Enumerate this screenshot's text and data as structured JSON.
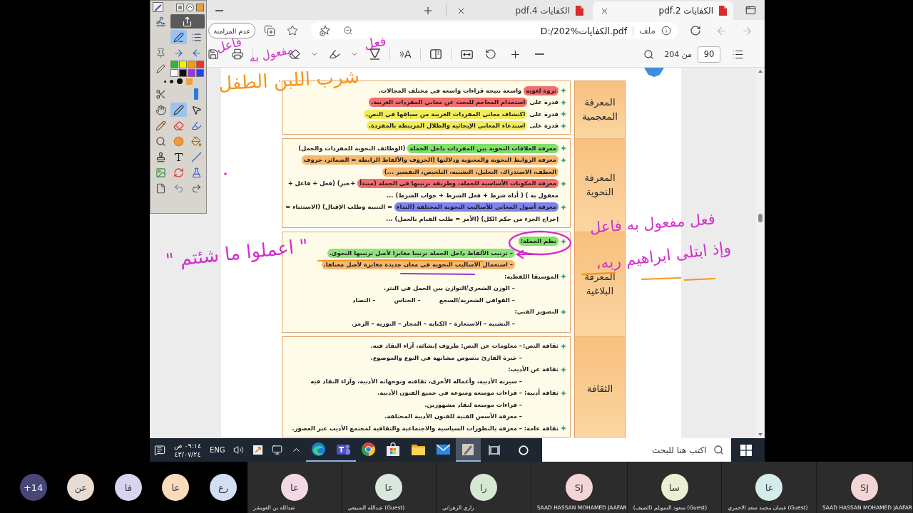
{
  "browser": {
    "tabs": [
      {
        "title": "الكفايات 2.pdf",
        "selected": true
      },
      {
        "title": "الكفايات 4.pdf",
        "selected": false
      }
    ],
    "nav": [
      {
        "kind": "back",
        "disabled": true
      },
      {
        "kind": "forward",
        "disabled": true
      },
      {
        "kind": "refresh",
        "disabled": false
      }
    ],
    "address": {
      "scheme": "ملف",
      "url": "D:/202%الكفايات.pdf"
    },
    "sync_button": "عدم المزامنة"
  },
  "pdf_toolbar": {
    "page": "90",
    "page_count": "من 204",
    "tool_groups": [
      [
        {
          "kind": "zoom_out",
          "menu": false
        },
        {
          "kind": "zoom_in",
          "menu": false
        },
        {
          "kind": "rotate",
          "menu": false
        },
        {
          "kind": "fit_width",
          "menu": false
        }
      ],
      [
        {
          "kind": "page_view",
          "menu": false
        }
      ],
      [
        {
          "kind": "read_aloud",
          "label": "A",
          "menu": false
        }
      ],
      [
        {
          "kind": "draw",
          "menu": true
        },
        {
          "kind": "highlight",
          "menu": true
        },
        {
          "kind": "erase",
          "menu": false
        }
      ],
      [
        {
          "kind": "print",
          "menu": false
        },
        {
          "kind": "save",
          "menu": false
        }
      ]
    ]
  },
  "document": {
    "sections": [
      {
        "heading": "المعرفة المعجمية",
        "kind": "list",
        "lines": [
          {
            "kind": "bullet",
            "parts": [
              {
                "text": "ثروة لغوية",
                "color": "#f26d6d"
              },
              {
                "text": "واسعة نتيجة قراءات واسعة في مختلف المجالات."
              }
            ]
          },
          {
            "kind": "bullet",
            "parts": [
              {
                "text": "قدرة على"
              },
              {
                "text": "استخدام المعاجم للبحث عن معاني المفردات الغريبة.",
                "color": "#f26d6d"
              }
            ]
          },
          {
            "kind": "bullet",
            "parts": [
              {
                "text": "قدرة على"
              },
              {
                "text": "اكتشاف معاني المفردات الغريبة من سياقها في النص.",
                "color": "#f3ec5a"
              }
            ]
          },
          {
            "kind": "bullet",
            "parts": [
              {
                "text": "قدرة على"
              },
              {
                "text": "استدعاء المعاني الإيحائية والظلال المرتبطة بالمفردة.",
                "color": "#f3ec5a"
              }
            ]
          }
        ]
      },
      {
        "heading": "المعرفة النحوية",
        "kind": "list",
        "lines": [
          {
            "kind": "bullet",
            "parts": [
              {
                "text": "معرفة العلاقات النحوية بين المفردات داخل الجملة",
                "color": "#7fe06c"
              },
              {
                "text": "(الوظائف النحوية للمفردات والجمل)"
              }
            ]
          },
          {
            "kind": "bullet",
            "parts": [
              {
                "text": "معرفة الروابط النحوية والمعنوية ودلالتها (الحروف والألفاظ الرابطة = الضمائر، حروف",
                "color": "#f6b86e"
              }
            ]
          },
          {
            "kind": "continuation",
            "parts": [
              {
                "text": "العطف، الاستدراك، التعليل، التشبيه، التلخيص، التفسير ...)",
                "color": "#f6b86e"
              }
            ]
          },
          {
            "kind": "bullet",
            "parts": [
              {
                "text": "معرفة المكونات الأساسية للجملة، وطريقة ترتيبها في الجملة (مبتدأ",
                "color": "#f26d6d"
              },
              {
                "text": "+خبر) (فعل + فاعل +"
              }
            ]
          },
          {
            "kind": "continuation",
            "parts": [
              {
                "text": "معفول به ) ( أداة شرط + فعل الشرط + جواب الشرط) ..."
              }
            ]
          },
          {
            "kind": "bullet",
            "parts": [
              {
                "text": "معرفة أصول المعاني للأساليب النحوية المختلفة (النداء",
                "color": "#7d83ee"
              },
              {
                "text": "= التنبيه وطلب الإقبال) (الاستثناء ="
              }
            ]
          },
          {
            "kind": "continuation",
            "parts": [
              {
                "text": "إخراج الجزء من حكم الكل) (الأمر = طلب القيام بالعمل) ..."
              }
            ]
          }
        ]
      },
      {
        "heading": "المعرفة البلاغية",
        "kind": "list",
        "lines": [
          {
            "kind": "bullet",
            "parts": [
              {
                "text": "نظم الجملة:",
                "color": "#7fe06c"
              }
            ]
          },
          {
            "kind": "dash",
            "parts": [
              {
                "text": "– ترتيب الألفاظ داخل الجملة ترتيبا مغايرا لأصل ترتيبها النحوي.",
                "color": "#8fe27c"
              }
            ]
          },
          {
            "kind": "dash",
            "parts": [
              {
                "text": "– استعمال الأساليب النحوية في معان جديدة مغايرة لأصل معناها.",
                "color": "#f6b86e"
              }
            ]
          },
          {
            "kind": "bullet",
            "parts": [
              {
                "text": "الموسيقا اللفظية:"
              }
            ]
          },
          {
            "kind": "dash",
            "parts": [
              {
                "text": "– الوزن الشعري/التوازن بين الجمل في النثر."
              }
            ]
          },
          {
            "kind": "dash",
            "parts": [
              {
                "text": "– القوافي الشعرية/السجع"
              },
              {
                "text": "– الجناس"
              },
              {
                "text": "– التضاد"
              }
            ]
          },
          {
            "kind": "bullet",
            "parts": [
              {
                "text": "التصوير الفني:"
              }
            ]
          },
          {
            "kind": "dash",
            "parts": [
              {
                "text": "– التشبيه – الاستعارة – الكناية – المجاز – التورية – الرمز."
              }
            ]
          }
        ]
      },
      {
        "heading": "الثقافة",
        "kind": "labeled",
        "rows": [
          {
            "label": "ثقافة النص:",
            "parts": [
              {
                "text": "– معلومات عن النص: ظروف إنشائه، آراء النقاد فيه."
              }
            ]
          },
          {
            "parts": [
              {
                "text": "– خبرة القارئ بنصوص مشابهة في النوع والموضوع."
              }
            ]
          },
          {
            "label": "ثقافة عن الأديب:"
          },
          {
            "parts": [
              {
                "text": "– سيرته الأدبية، وأعماله الأخرى، ثقافته وتوجهاته الأدبية، وآراء النقاد فيه"
              }
            ]
          },
          {
            "label": "ثقافة أدبية:",
            "parts": [
              {
                "text": "– قراءات موسعة ومنوعة في جميع الفنون الأدبية."
              }
            ]
          },
          {
            "parts": [
              {
                "text": "– قراءات موسعة لنقاد مشهورين."
              }
            ]
          },
          {
            "parts": [
              {
                "text": "– معرفة الأسس الفنية للفنون الأدبية المختلفة."
              }
            ]
          },
          {
            "label": "ثقافة عامة:",
            "parts": [
              {
                "text": "– معرفة بالتطورات السياسية والاجتماعية والثقافية لمجتمع الأديب عبر العصور."
              }
            ]
          }
        ]
      }
    ]
  },
  "ink": {
    "texts": [
      {
        "text": "فعل",
        "color": "#d22fce"
      },
      {
        "text": "مفعول به",
        "color": "#d22fce"
      },
      {
        "text": "فاعل",
        "color": "#d22fce"
      },
      {
        "text": "شرب اللبن الطفل",
        "color": "#f5961f"
      },
      {
        "text": "\" اعملوا ما شئتم \"",
        "color": "#d22fce"
      },
      {
        "text": "فعل مفعول به فاعل",
        "color": "#d22fce"
      },
      {
        "text": "وإذ ابتلى ابراهيم ربه،",
        "color": "#d22fce"
      }
    ],
    "strokes": [
      {
        "kind": "ellipse",
        "color": "#d22fce"
      },
      {
        "kind": "arrow",
        "color": "#d22fce"
      },
      {
        "kind": "underline",
        "color": "#f5961f"
      },
      {
        "kind": "underline",
        "color": "#a033d8"
      },
      {
        "kind": "strike",
        "color": "#f5961f"
      },
      {
        "kind": "underline",
        "color": "#f5961f"
      },
      {
        "kind": "dot",
        "color": "#d22fce"
      }
    ]
  },
  "palette": {
    "top_tools": [
      {
        "kind": "signature",
        "selected": false
      },
      {
        "kind": "share",
        "selected": false
      },
      {
        "kind": "ink",
        "selected": true
      },
      {
        "kind": "list",
        "selected": false
      },
      {
        "kind": "pin",
        "selected": false
      },
      {
        "kind": "next",
        "selected": false
      },
      {
        "kind": "previous",
        "selected": false
      }
    ],
    "swatches": [
      {
        "color": "#22c222"
      },
      {
        "color": "#f2f200"
      },
      {
        "color": "#ff9a00"
      },
      {
        "color": "#ff2a2a"
      },
      {
        "color": "#ffffff"
      },
      {
        "color": "#111111"
      },
      {
        "color": "#a52ee8"
      },
      {
        "color": "#2a3cff"
      }
    ],
    "tools": [
      {
        "kind": "clip",
        "selected": false
      },
      {
        "kind": "width",
        "selected": false
      },
      {
        "kind": "hand",
        "selected": false
      },
      {
        "kind": "pen",
        "selected": true
      },
      {
        "kind": "pointer",
        "selected": false
      },
      {
        "kind": "pencil",
        "selected": false
      },
      {
        "kind": "eraser",
        "selected": false
      },
      {
        "kind": "marker",
        "selected": false
      },
      {
        "kind": "magnifier",
        "selected": false
      },
      {
        "kind": "circle",
        "selected": false
      },
      {
        "kind": "bucket",
        "selected": false
      },
      {
        "kind": "stamp",
        "selected": false
      },
      {
        "kind": "text",
        "selected": false
      },
      {
        "kind": "line",
        "selected": false
      },
      {
        "kind": "image",
        "selected": false
      },
      {
        "kind": "refresh",
        "selected": false
      },
      {
        "kind": "flask",
        "selected": false
      },
      {
        "kind": "page",
        "selected": false
      },
      {
        "kind": "undo",
        "selected": false
      },
      {
        "kind": "redo",
        "selected": false
      }
    ]
  },
  "taskbar": {
    "search_placeholder": "اكتب هنا للبحث",
    "time": "٠٩:١٤ ص",
    "date": "٤٣/٠٧/٢٤",
    "language": "ENG",
    "apps": [
      {
        "kind": "edge",
        "selected": false,
        "running": true
      },
      {
        "kind": "teams",
        "selected": false,
        "running": true
      },
      {
        "kind": "chrome",
        "selected": false,
        "running": false
      },
      {
        "kind": "store",
        "selected": false,
        "running": false
      },
      {
        "kind": "explorer",
        "selected": false,
        "running": false
      },
      {
        "kind": "mail",
        "selected": false,
        "running": false
      },
      {
        "kind": "annotate",
        "selected": true,
        "running": true
      }
    ]
  },
  "participants": {
    "tiles": [
      {
        "initials": "SJ",
        "name": "SAAD HASSAN MOHAMED JAAFAR",
        "color": "#f4d5d5"
      },
      {
        "initials": "غا",
        "name": "غسان محمد سعد الاحمري (Guest)",
        "color": "#d5ecec"
      },
      {
        "initials": "سا",
        "name": "سعود السويلم (الضيف) (Guest)",
        "color": "#ebf0d5"
      },
      {
        "initials": "SJ",
        "name": "SAAD HASSAN MOHAMED JAAFAR",
        "color": "#f4d5d5"
      },
      {
        "initials": "را",
        "name": "رازي الزهراني",
        "color": "#d5e9d0"
      },
      {
        "initials": "عا",
        "name": "عبدالله السبيعي (Guest)",
        "color": "#d9e8dc"
      },
      {
        "initials": "عا",
        "name": "عبدالله بن العويشز",
        "color": "#f2d8e5"
      }
    ],
    "avatars": [
      {
        "initials": "رع",
        "color": "#d3def2"
      },
      {
        "initials": "عا",
        "color": "#f9dcbc"
      },
      {
        "initials": "فا",
        "color": "#d6d4ef"
      },
      {
        "initials": "عن",
        "color": "#e8dcd2"
      },
      {
        "initials": "+14",
        "color": "#464775"
      }
    ]
  }
}
